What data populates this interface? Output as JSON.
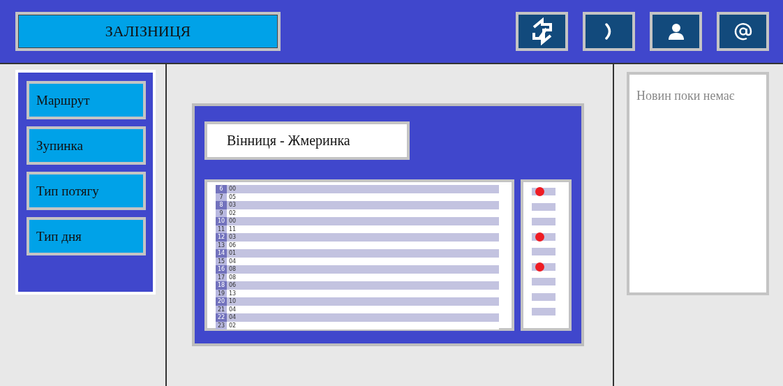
{
  "header": {
    "title": "ЗАЛІЗНИЦЯ",
    "icons": [
      {
        "kind": "refresh"
      },
      {
        "kind": "phone"
      },
      {
        "kind": "user"
      },
      {
        "kind": "at"
      }
    ]
  },
  "sidebar": {
    "items": [
      {
        "label": "Маршрут"
      },
      {
        "label": "Зупинка"
      },
      {
        "label": "Тип потягу"
      },
      {
        "label": "Тип дня"
      }
    ]
  },
  "route": {
    "title": "Вінниця - Жмеринка",
    "schedule": [
      {
        "hour": "6",
        "minute": "00"
      },
      {
        "hour": "7",
        "minute": "05"
      },
      {
        "hour": "8",
        "minute": "03"
      },
      {
        "hour": "9",
        "minute": "02"
      },
      {
        "hour": "10",
        "minute": "00"
      },
      {
        "hour": "11",
        "minute": "11"
      },
      {
        "hour": "12",
        "minute": "03"
      },
      {
        "hour": "13",
        "minute": "06"
      },
      {
        "hour": "14",
        "minute": "01"
      },
      {
        "hour": "15",
        "minute": "04"
      },
      {
        "hour": "16",
        "minute": "08"
      },
      {
        "hour": "17",
        "minute": "08"
      },
      {
        "hour": "18",
        "minute": "06"
      },
      {
        "hour": "19",
        "minute": "13"
      },
      {
        "hour": "20",
        "minute": "10"
      },
      {
        "hour": "21",
        "minute": "04"
      },
      {
        "hour": "22",
        "minute": "04"
      },
      {
        "hour": "23",
        "minute": "02"
      }
    ],
    "markers": [
      {
        "alert": true
      },
      {
        "alert": false
      },
      {
        "alert": false
      },
      {
        "alert": true
      },
      {
        "alert": false
      },
      {
        "alert": true
      },
      {
        "alert": false
      },
      {
        "alert": false
      },
      {
        "alert": false
      }
    ]
  },
  "news": {
    "text": "Новин поки немає"
  }
}
